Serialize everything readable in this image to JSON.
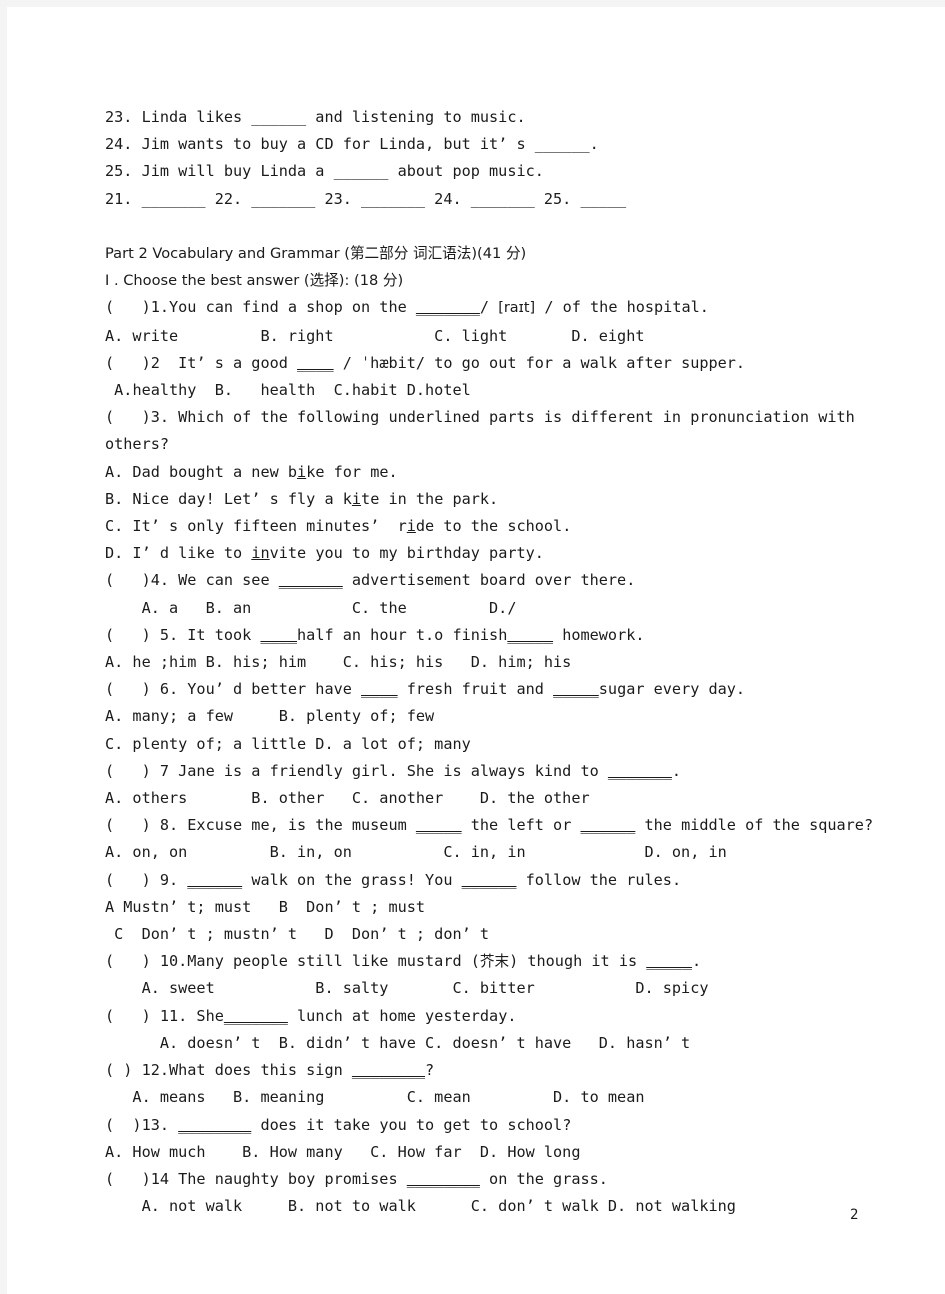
{
  "page": {
    "number": "2",
    "background_color": "#ffffff",
    "text_color": "#1b1b1b",
    "edge_color": "#f4f4f4"
  },
  "cloze_tail": {
    "items": [
      "23. Linda likes ______ and listening to music.",
      "24. Jim wants to buy a CD for Linda, but it’ s ______.",
      "25. Jim will buy Linda a ______ about pop music."
    ],
    "answer_row": "21. _______ 22. _______ 23. _______ 24. _______ 25. _____"
  },
  "part2": {
    "heading": "Part 2 Vocabulary and Grammar (第二部分 词汇语法)(41 分)",
    "section_heading": "Ⅰ . Choose the best answer (选择): (18 分)",
    "questions": [
      {
        "id": "q1",
        "stem_prefix": "(   )1.You can find a shop on the ",
        "stem_blank": "_______",
        "stem_mid": "/ ",
        "ipa": "[raɪt]",
        "stem_suffix": " / of the hospital.",
        "options_line": "A. write         B. right           C. light       D. eight"
      },
      {
        "id": "q2",
        "stem_prefix": "(   )2  It’ s a good ",
        "stem_blank": "____",
        "stem_suffix": " / ˈhæbit/ to go out for a walk after supper.",
        "options_line": " A.healthy  B.   health  C.habit D.hotel"
      },
      {
        "id": "q3",
        "stem_line_1": "(   )3. Which of the following underlined parts is different in pronunciation with",
        "stem_line_2": "others?",
        "options": [
          {
            "label": "A. Dad bought a new b",
            "underlined": "i",
            "rest": "ke for me."
          },
          {
            "label": "B. Nice day! Let’ s fly a k",
            "underlined": "i",
            "rest": "te in the park."
          },
          {
            "label": "C. It’ s only fifteen minutes’  r",
            "underlined": "i",
            "rest": "de to the school."
          },
          {
            "label": "D. I’ d like to ",
            "underlined": "in",
            "rest": "vite you to my birthday party."
          }
        ]
      },
      {
        "id": "q4",
        "stem_prefix": "(   )4. We can see ",
        "stem_blank": "_______",
        "stem_suffix": " advertisement board over there.",
        "options_line": "    A. a   B. an           C. the         D./"
      },
      {
        "id": "q5",
        "stem_prefix": "(   ) 5. It took ",
        "stem_blank_1": "____",
        "stem_mid": "half an hour t.o finish",
        "stem_blank_2": "_____",
        "stem_suffix": " homework.",
        "options_line": "A. he ;him B. his; him    C. his; his   D. him; his"
      },
      {
        "id": "q6",
        "stem_prefix": "(   ) 6. You’ d better have ",
        "stem_blank_1": "____",
        "stem_mid": " fresh fruit and ",
        "stem_blank_2": "_____",
        "stem_suffix": "sugar every day.",
        "options_line_1": "A. many; a few     B. plenty of; few",
        "options_line_2": "C. plenty of; a little D. a lot of; many"
      },
      {
        "id": "q7",
        "stem_prefix": "(   ) 7 Jane is a friendly girl. She is always kind to ",
        "stem_blank": "_______",
        "stem_suffix": ".",
        "options_line": "A. others       B. other   C. another    D. the other"
      },
      {
        "id": "q8",
        "stem_prefix": "(   ) 8. Excuse me, is the museum ",
        "stem_blank_1": "_____",
        "stem_mid": " the left or ",
        "stem_blank_2": "______",
        "stem_suffix": " the middle of the square?",
        "options_line": "A. on, on         B. in, on          C. in, in             D. on, in"
      },
      {
        "id": "q9",
        "stem_prefix": "(   ) 9. ",
        "stem_blank_1": "______",
        "stem_mid": " walk on the grass! You ",
        "stem_blank_2": "______",
        "stem_suffix": " follow the rules.",
        "options_line_1": "A Mustn’ t; must   B  Don’ t ; must",
        "options_line_2": " C  Don’ t ; mustn’ t   D  Don’ t ; don’ t"
      },
      {
        "id": "q10",
        "stem_prefix": "(   ) 10.Many people still like mustard (",
        "chinese_gloss": "芥末",
        "stem_mid": ") though it is ",
        "stem_blank": "_____",
        "stem_suffix": ".",
        "options_line": "    A. sweet           B. salty       C. bitter           D. spicy"
      },
      {
        "id": "q11",
        "stem_prefix": "(   ) 11. She",
        "stem_blank": "_______",
        "stem_suffix": " lunch at home yesterday.",
        "options_line": "      A. doesn’ t  B. didn’ t have C. doesn’ t have   D. hasn’ t"
      },
      {
        "id": "q12",
        "stem_prefix": "( ) 12.What does this sign ",
        "stem_blank": "________",
        "stem_suffix": "?",
        "options_line": "   A. means   B. meaning         C. mean         D. to mean"
      },
      {
        "id": "q13",
        "stem_prefix": "(  )13. ",
        "stem_blank": "________",
        "stem_suffix": " does it take you to get to school?",
        "options_line": "A. How much    B. How many   C. How far  D. How long"
      },
      {
        "id": "q14",
        "stem_prefix": "(   )14 The naughty boy promises ",
        "stem_blank": "________",
        "stem_suffix": " on the grass.",
        "options_line": "    A. not walk     B. not to walk      C. don’ t walk D. not walking"
      }
    ]
  }
}
